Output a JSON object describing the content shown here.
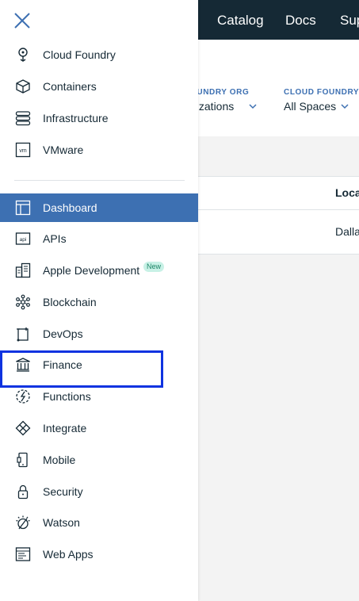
{
  "header": {
    "nav": [
      "Catalog",
      "Docs",
      "Sup"
    ]
  },
  "filters": [
    {
      "label": "OUNDRY ORG",
      "value": "nizations"
    },
    {
      "label": "CLOUD FOUNDRY S",
      "value": "All Spaces"
    }
  ],
  "table": {
    "header": "Loca",
    "row_value": "Dalla"
  },
  "drawer": {
    "close_icon": "close-icon",
    "infra_items": [
      {
        "label": "Cloud Foundry",
        "icon": "cloud-foundry-icon"
      },
      {
        "label": "Containers",
        "icon": "containers-icon"
      },
      {
        "label": "Infrastructure",
        "icon": "infrastructure-icon"
      },
      {
        "label": "VMware",
        "icon": "vmware-icon"
      }
    ],
    "items": [
      {
        "label": "Dashboard",
        "icon": "dashboard-icon",
        "active": true
      },
      {
        "label": "APIs",
        "icon": "api-icon"
      },
      {
        "label": "Apple Development",
        "icon": "apple-development-icon",
        "badge": "New"
      },
      {
        "label": "Blockchain",
        "icon": "blockchain-icon"
      },
      {
        "label": "DevOps",
        "icon": "devops-icon"
      },
      {
        "label": "Finance",
        "icon": "finance-icon"
      },
      {
        "label": "Functions",
        "icon": "functions-icon"
      },
      {
        "label": "Integrate",
        "icon": "integrate-icon"
      },
      {
        "label": "Mobile",
        "icon": "mobile-icon"
      },
      {
        "label": "Security",
        "icon": "security-icon"
      },
      {
        "label": "Watson",
        "icon": "watson-icon"
      },
      {
        "label": "Web Apps",
        "icon": "web-apps-icon"
      }
    ]
  },
  "colors": {
    "topbar": "#152935",
    "accent": "#3d70b2",
    "highlight": "#0f33e0"
  }
}
